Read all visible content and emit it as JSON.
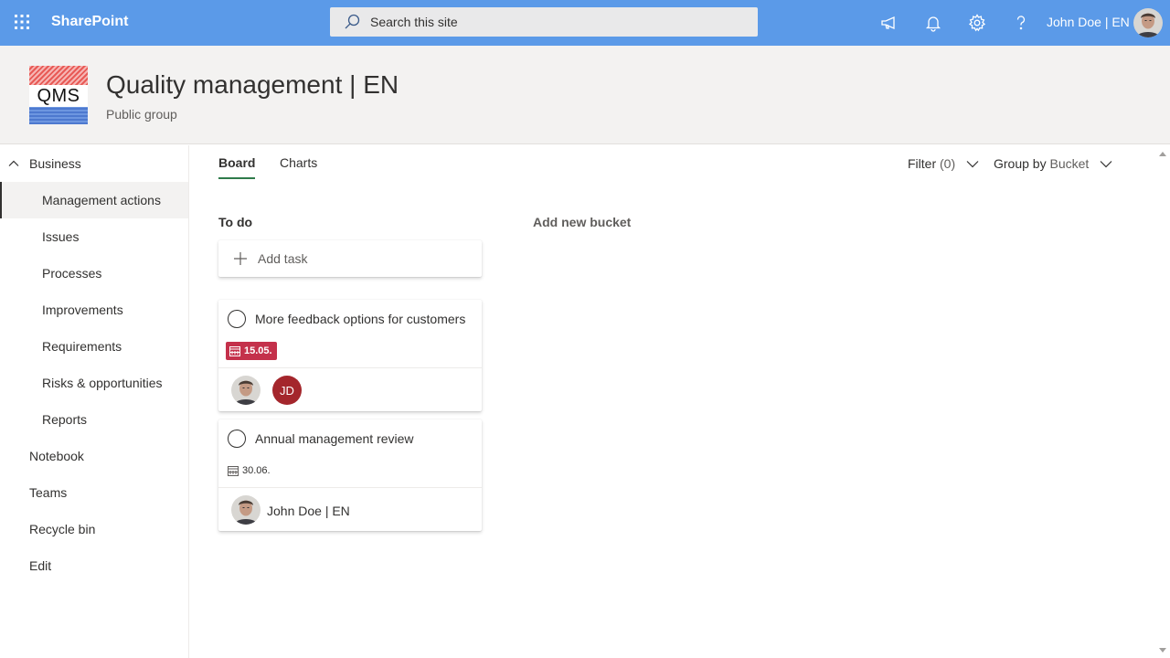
{
  "suitebar": {
    "brand": "SharePoint",
    "search_placeholder": "Search this site",
    "user_name": "John Doe | EN",
    "colors": {
      "bar": "#5b9ae8"
    }
  },
  "site": {
    "logo_text": "QMS",
    "title": "Quality management | EN",
    "subtitle": "Public group"
  },
  "leftnav": {
    "items": [
      {
        "label": "Business",
        "level": 1,
        "expanded": true
      },
      {
        "label": "Management actions",
        "level": 2,
        "active": true
      },
      {
        "label": "Issues",
        "level": 2
      },
      {
        "label": "Processes",
        "level": 2
      },
      {
        "label": "Improvements",
        "level": 2
      },
      {
        "label": "Requirements",
        "level": 2
      },
      {
        "label": "Risks & opportunities",
        "level": 2
      },
      {
        "label": "Reports",
        "level": 2
      },
      {
        "label": "Notebook",
        "level": 1
      },
      {
        "label": "Teams",
        "level": 1
      },
      {
        "label": "Recycle bin",
        "level": 1
      },
      {
        "label": "Edit",
        "level": 1
      }
    ]
  },
  "planner": {
    "tabs": [
      {
        "label": "Board",
        "active": true
      },
      {
        "label": "Charts",
        "active": false
      }
    ],
    "filter": {
      "label": "Filter",
      "count": "(0)"
    },
    "groupby": {
      "label": "Group by",
      "value": "Bucket"
    },
    "bucket": {
      "name": "To do",
      "add_task_label": "Add task"
    },
    "add_bucket_label": "Add new bucket",
    "tasks": [
      {
        "title": "More feedback options for customers",
        "due": "15.05.",
        "overdue": true,
        "assignee_initials": "JD"
      },
      {
        "title": "Annual management review",
        "due": "30.06.",
        "overdue": false,
        "assignee_name": "John Doe | EN"
      }
    ],
    "colors": {
      "overdue": "#c4314b",
      "initials_bg": "#a4262c",
      "tab_underline": "#2f7b4b"
    }
  }
}
